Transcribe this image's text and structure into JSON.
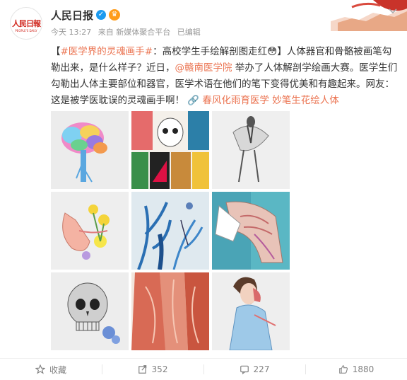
{
  "post": {
    "author": "人民日报",
    "avatar_text": "人民日報",
    "avatar_subtext": "PEOPLE'S DAILY",
    "time": "今天 13:27",
    "source": "来自 新媒体聚合平台",
    "edited": "已编辑",
    "text": {
      "bracket_open": "【",
      "hashtag": "#医学界的灵魂画手#",
      "part1": "：高校学生手绘解剖图走红",
      "emoji": "😳",
      "part2": "】人体器官和骨骼被画笔勾勒出来，是什么样子？近日，",
      "mention": "@赣南医学院",
      "part3": " 举办了人体解剖学绘画大赛。医学生们勾勒出人体主要部位和器官，医学术语在他们的笔下变得优美和有趣起来。网友：这是被学医耽误的灵魂画手啊！",
      "link_icon": "🔗",
      "link_text": "春风化雨育医学 妙笔生花绘人体"
    },
    "images": [
      {
        "name": "image-brain"
      },
      {
        "name": "image-skull-collage"
      },
      {
        "name": "image-flower-skeleton"
      },
      {
        "name": "image-ear-flowers"
      },
      {
        "name": "image-blue-vessels"
      },
      {
        "name": "image-hand-muscles"
      },
      {
        "name": "image-skull-pencil"
      },
      {
        "name": "image-neck-muscles"
      },
      {
        "name": "image-woman-anatomy"
      }
    ]
  },
  "actions": {
    "favorite": "收藏",
    "repost": "352",
    "comment": "227",
    "like": "1880"
  },
  "colors": {
    "accent": "#eb7350",
    "text": "#333333",
    "muted": "#999999",
    "verified": "#1d9bf0"
  }
}
